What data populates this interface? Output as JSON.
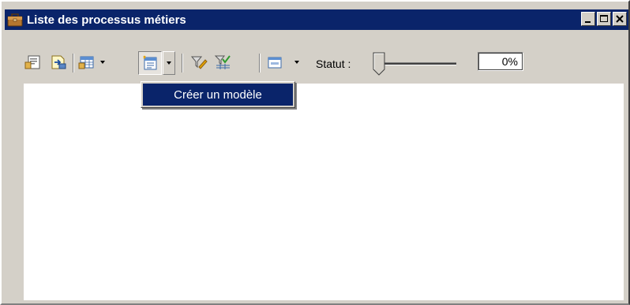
{
  "window": {
    "title": "Liste des processus métiers",
    "controls": [
      "minimize-icon",
      "maximize-icon",
      "close-icon"
    ]
  },
  "toolbar": {
    "buttons": [
      {
        "name": "properties-icon"
      },
      {
        "name": "export-icon"
      },
      {
        "name": "table-icon",
        "dropdown": true
      },
      {
        "name": "new-model-icon",
        "dropdown": true,
        "pressed": true
      },
      {
        "name": "filter-edit-icon"
      },
      {
        "name": "filter-check-icon"
      },
      {
        "name": "window-icon",
        "dropdown": true
      }
    ],
    "status_label": "Statut :",
    "status_value": "0%",
    "status_level": 0
  },
  "dropdown_menu": {
    "items": [
      {
        "label": "Créer un modèle",
        "highlighted": true
      }
    ]
  },
  "colors": {
    "titlebar": "#0a246a",
    "face": "#d4d0c8",
    "highlight": "#0a246a"
  }
}
